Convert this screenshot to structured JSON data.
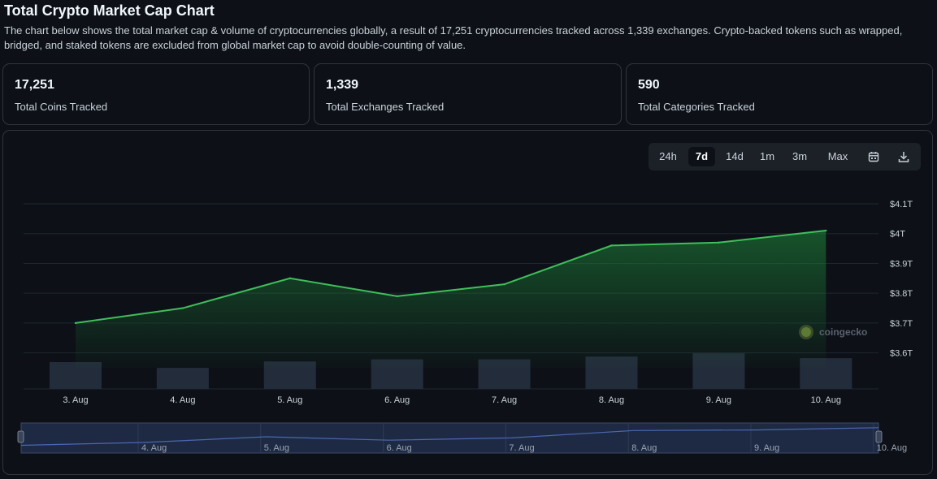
{
  "page": {
    "title": "Total Crypto Market Cap Chart",
    "description": "The chart below shows the total market cap & volume of cryptocurrencies globally, a result of 17,251 cryptocurrencies tracked across 1,339 exchanges. Crypto-backed tokens such as wrapped, bridged, and staked tokens are excluded from global market cap to avoid double-counting of value."
  },
  "stats": [
    {
      "value": "17,251",
      "label": "Total Coins Tracked"
    },
    {
      "value": "1,339",
      "label": "Total Exchanges Tracked"
    },
    {
      "value": "590",
      "label": "Total Categories Tracked"
    }
  ],
  "toolbar": {
    "ranges": [
      "24h",
      "7d",
      "14d",
      "1m",
      "3m",
      "Max"
    ],
    "active": "7d",
    "icons": [
      "calendar-icon",
      "download-icon"
    ]
  },
  "watermark": "coingecko",
  "colors": {
    "line": "#3fbf5a",
    "volume_bar": "#232c3b",
    "background": "#0d1117",
    "navigator_fill": "#1e2a44",
    "navigator_line": "#4a67b0"
  },
  "chart_data": {
    "type": "line",
    "title": "",
    "xlabel": "",
    "ylabel": "",
    "categories": [
      "3. Aug",
      "4. Aug",
      "5. Aug",
      "6. Aug",
      "7. Aug",
      "8. Aug",
      "9. Aug",
      "10. Aug"
    ],
    "series": [
      {
        "values": [
          3.7,
          3.75,
          3.85,
          3.79,
          3.83,
          3.96,
          3.97,
          4.01
        ]
      }
    ],
    "volume_values": [
      88,
      69,
      90,
      97,
      97,
      106,
      117,
      101
    ],
    "y_ticks": [
      "$3.6T",
      "$3.7T",
      "$3.8T",
      "$3.9T",
      "$4T",
      "$4.1T"
    ],
    "y_tick_values": [
      3.6,
      3.7,
      3.8,
      3.9,
      4.0,
      4.1
    ],
    "ylim": [
      3.55,
      4.1
    ],
    "grid": true,
    "legend": "none",
    "navigator": {
      "labels": [
        "4. Aug",
        "5. Aug",
        "6. Aug",
        "7. Aug",
        "8. Aug",
        "9. Aug",
        "10. Aug"
      ]
    }
  }
}
